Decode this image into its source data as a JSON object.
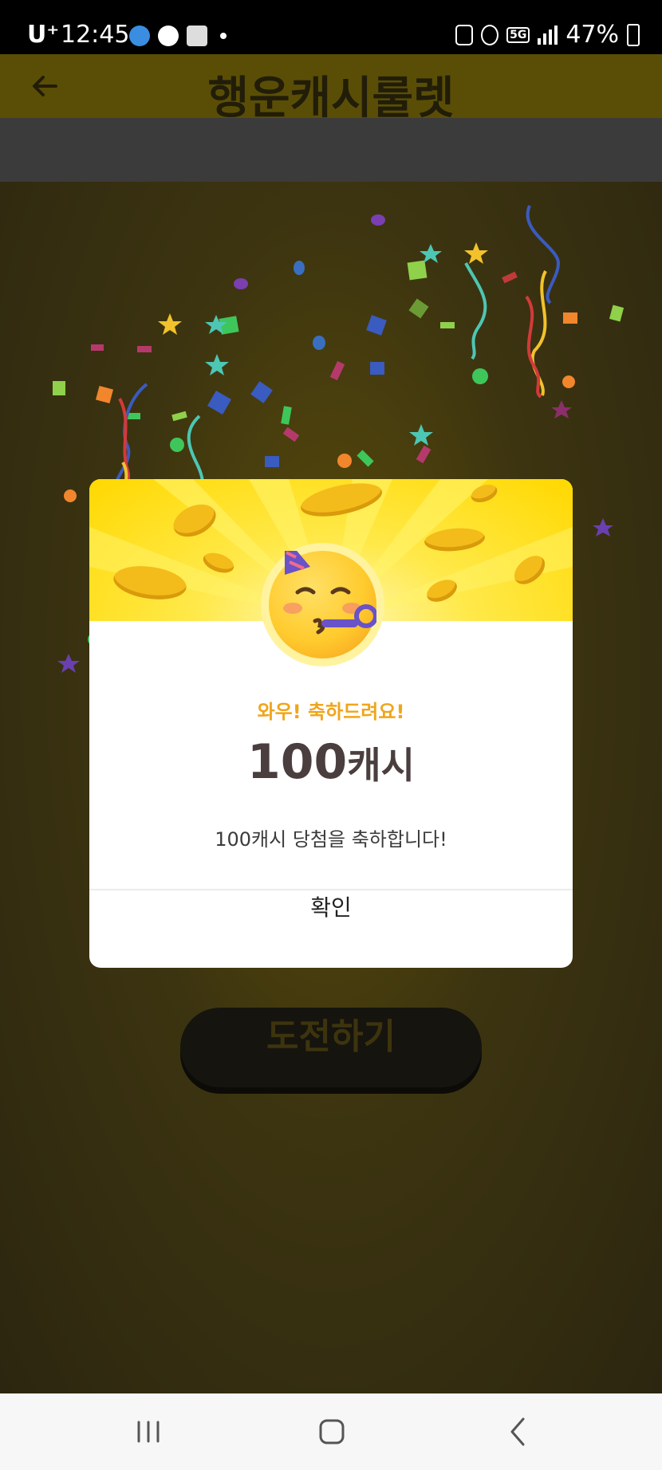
{
  "status_bar": {
    "carrier": "U⁺",
    "time": "12:45",
    "network": "5G",
    "battery": "47%"
  },
  "header": {
    "title": "행운캐시룰렛"
  },
  "background": {
    "challenge_label": "도전하기"
  },
  "dialog": {
    "congrats": "와우! 축하드려요!",
    "amount_number": "100",
    "amount_unit": "캐시",
    "message": "100캐시 당첨을 축하합니다!",
    "confirm_label": "확인",
    "accent_color": "#f0a51a",
    "banner_color": "#ffdf1e"
  },
  "nav": {
    "recents_icon": "recents-icon",
    "home_icon": "home-icon",
    "back_icon": "back-icon"
  }
}
